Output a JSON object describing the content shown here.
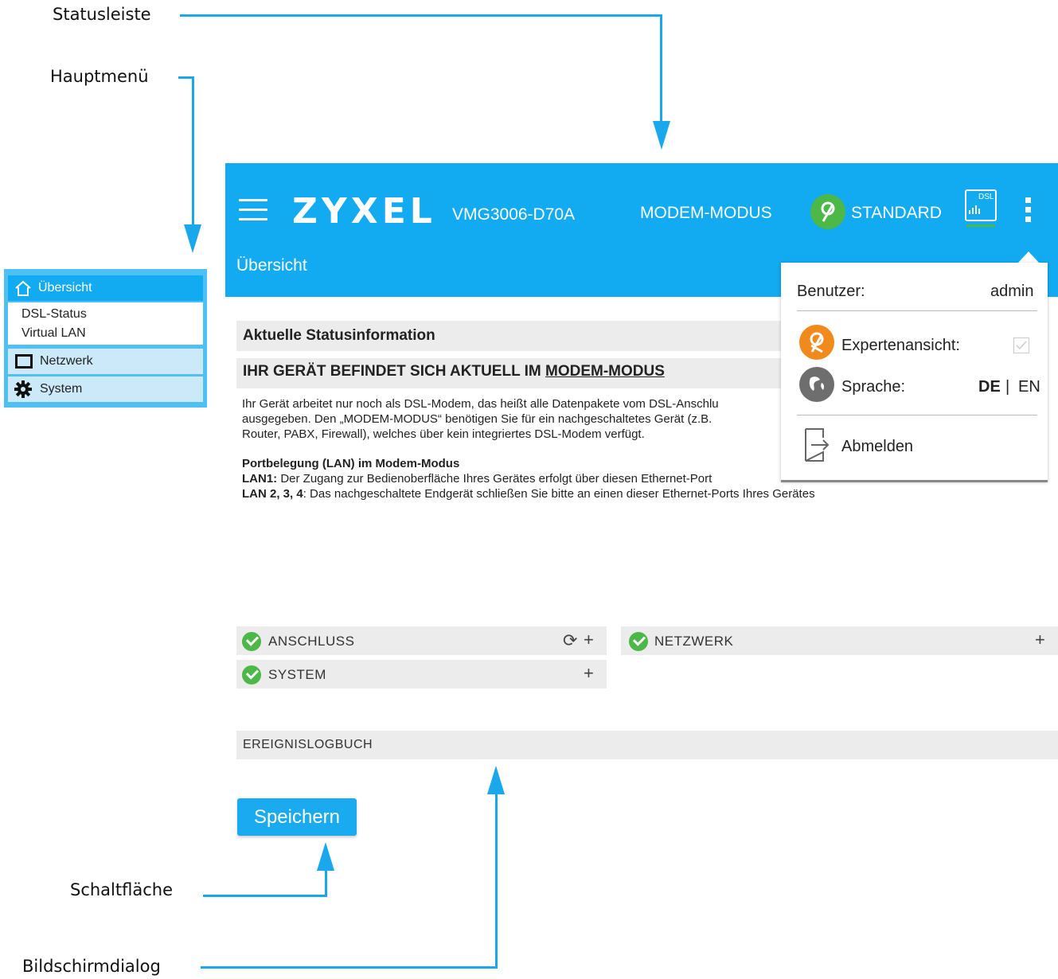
{
  "callouts": {
    "statusleiste": "Statusleiste",
    "hauptmenue": "Hauptmenü",
    "schaltflaeche": "Schaltfläche",
    "bildschirmdialog": "Bildschirmdialog"
  },
  "header": {
    "brand": "ZYXEL",
    "model": "VMG3006-D70A",
    "mode": "MODEM-MODUS",
    "view": "STANDARD",
    "dsl_label": "DSL",
    "breadcrumb": "Übersicht"
  },
  "sidebar": {
    "items": [
      {
        "label": "Übersicht",
        "icon": "home-icon"
      },
      {
        "label": "DSL-Status"
      },
      {
        "label": "Virtual LAN"
      },
      {
        "label": "Netzwerk",
        "icon": "network-icon"
      },
      {
        "label": "System",
        "icon": "gear-icon"
      }
    ]
  },
  "user_menu": {
    "user_label": "Benutzer:",
    "user_value": "admin",
    "expert_label": "Expertenansicht:",
    "language_label": "Sprache:",
    "lang_de": "DE",
    "lang_sep": "|",
    "lang_en": "EN",
    "logout_label": "Abmelden"
  },
  "content": {
    "status_title": "Aktuelle Statusinformation",
    "mode_heading_prefix": "IHR GERÄT BEFINDET SICH AKTUELL IM ",
    "mode_heading_link": "MODEM-MODUS",
    "para_lines": [
      "Ihr Gerät arbeitet nur noch als DSL-Modem, das heißt alle Datenpakete vom DSL-Anschlu",
      "ausgegeben. Den „MODEM-MODUS“ benötigen Sie für ein nachgeschaltetes Gerät (z.B.",
      "Router, PABX, Firewall), welches über kein integriertes DSL-Modem verfügt."
    ],
    "port_title": "Portbelegung (LAN) im Modem-Modus",
    "lan1_bold": "LAN1:",
    "lan1_text": " Der Zugang zur Bedienoberfläche Ihres Gerätes erfolgt über diesen Ethernet-Port",
    "lan234_bold": "LAN 2, 3, 4",
    "lan234_text": ": Das nachgeschaltete Endgerät schließen Sie bitte an einen dieser Ethernet-Ports Ihres Gerätes"
  },
  "panels": {
    "anschluss": "ANSCHLUSS",
    "netzwerk": "NETZWERK",
    "system": "SYSTEM",
    "plus": "+",
    "refresh": "⟳"
  },
  "logbook": "EREIGNISLOGBUCH",
  "save_button": "Speichern",
  "colors": {
    "accent": "#12aaf0",
    "callout_line": "#1aa7ec",
    "ok_green": "#4cb848",
    "expert_orange": "#f08a1c",
    "panel_grey": "#ececec"
  }
}
